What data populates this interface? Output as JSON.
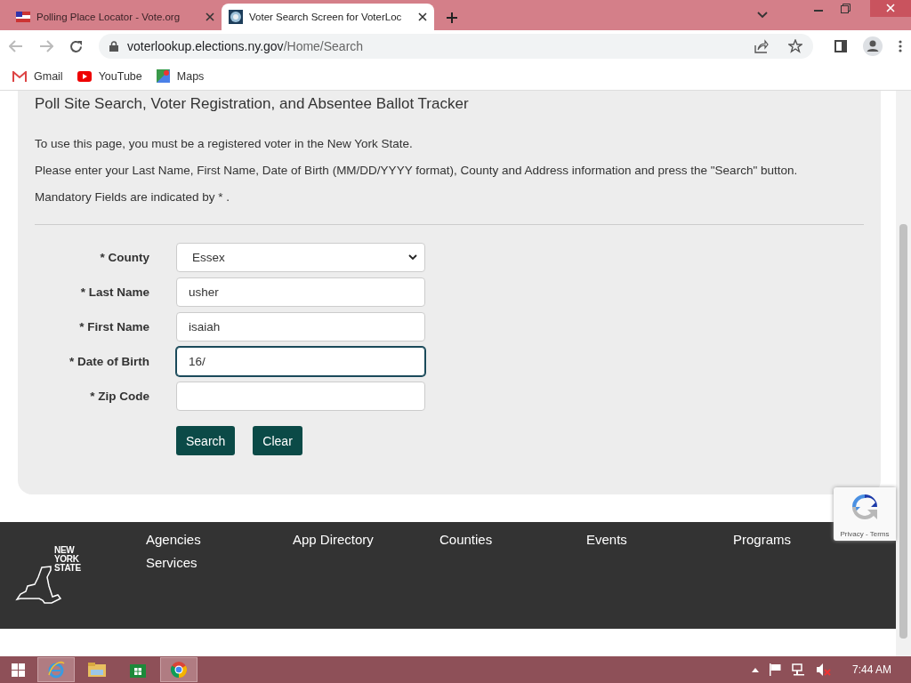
{
  "browser": {
    "tabs": [
      {
        "title": "Polling Place Locator - Vote.org",
        "selected": false
      },
      {
        "title": "Voter Search Screen for VoterLoc",
        "selected": true
      }
    ],
    "url_host": "voterlookup.elections.ny.gov",
    "url_path": "/Home/Search",
    "bookmarks": [
      {
        "label": "Gmail",
        "kind": "gmail"
      },
      {
        "label": "YouTube",
        "kind": "youtube"
      },
      {
        "label": "Maps",
        "kind": "maps"
      }
    ]
  },
  "page": {
    "title": "Poll Site Search, Voter Registration, and Absentee Ballot Tracker",
    "paragraphs": [
      "To use this page, you must be a registered voter in the New York State.",
      "Please enter your Last Name, First Name, Date of Birth (MM/DD/YYYY format), County and Address information and press the \"Search\" button.",
      "Mandatory Fields are indicated by * ."
    ],
    "fields": [
      {
        "label": "* County",
        "kind": "select",
        "value": "Essex",
        "focused": false
      },
      {
        "label": "* Last Name",
        "kind": "text",
        "value": "usher",
        "focused": false
      },
      {
        "label": "* First Name",
        "kind": "text",
        "value": "isaiah",
        "focused": false
      },
      {
        "label": "* Date of Birth",
        "kind": "text",
        "value": "16/",
        "focused": true
      },
      {
        "label": "* Zip Code",
        "kind": "text",
        "focused": false
      }
    ],
    "buttons": [
      "Search",
      "Clear"
    ]
  },
  "recaptcha": {
    "text": "Privacy - Terms"
  },
  "footer": {
    "logo_lines": [
      "NEW",
      "YORK",
      "STATE"
    ],
    "links": [
      "Agencies",
      "App Directory",
      "Counties",
      "Events",
      "Programs",
      "Services"
    ]
  },
  "taskbar": {
    "apps": [
      {
        "kind": "browser-e",
        "selected": true
      },
      {
        "kind": "folder",
        "selected": false
      },
      {
        "kind": "store",
        "selected": false
      },
      {
        "kind": "chrome",
        "selected": true
      }
    ],
    "time": "7:44 AM"
  }
}
